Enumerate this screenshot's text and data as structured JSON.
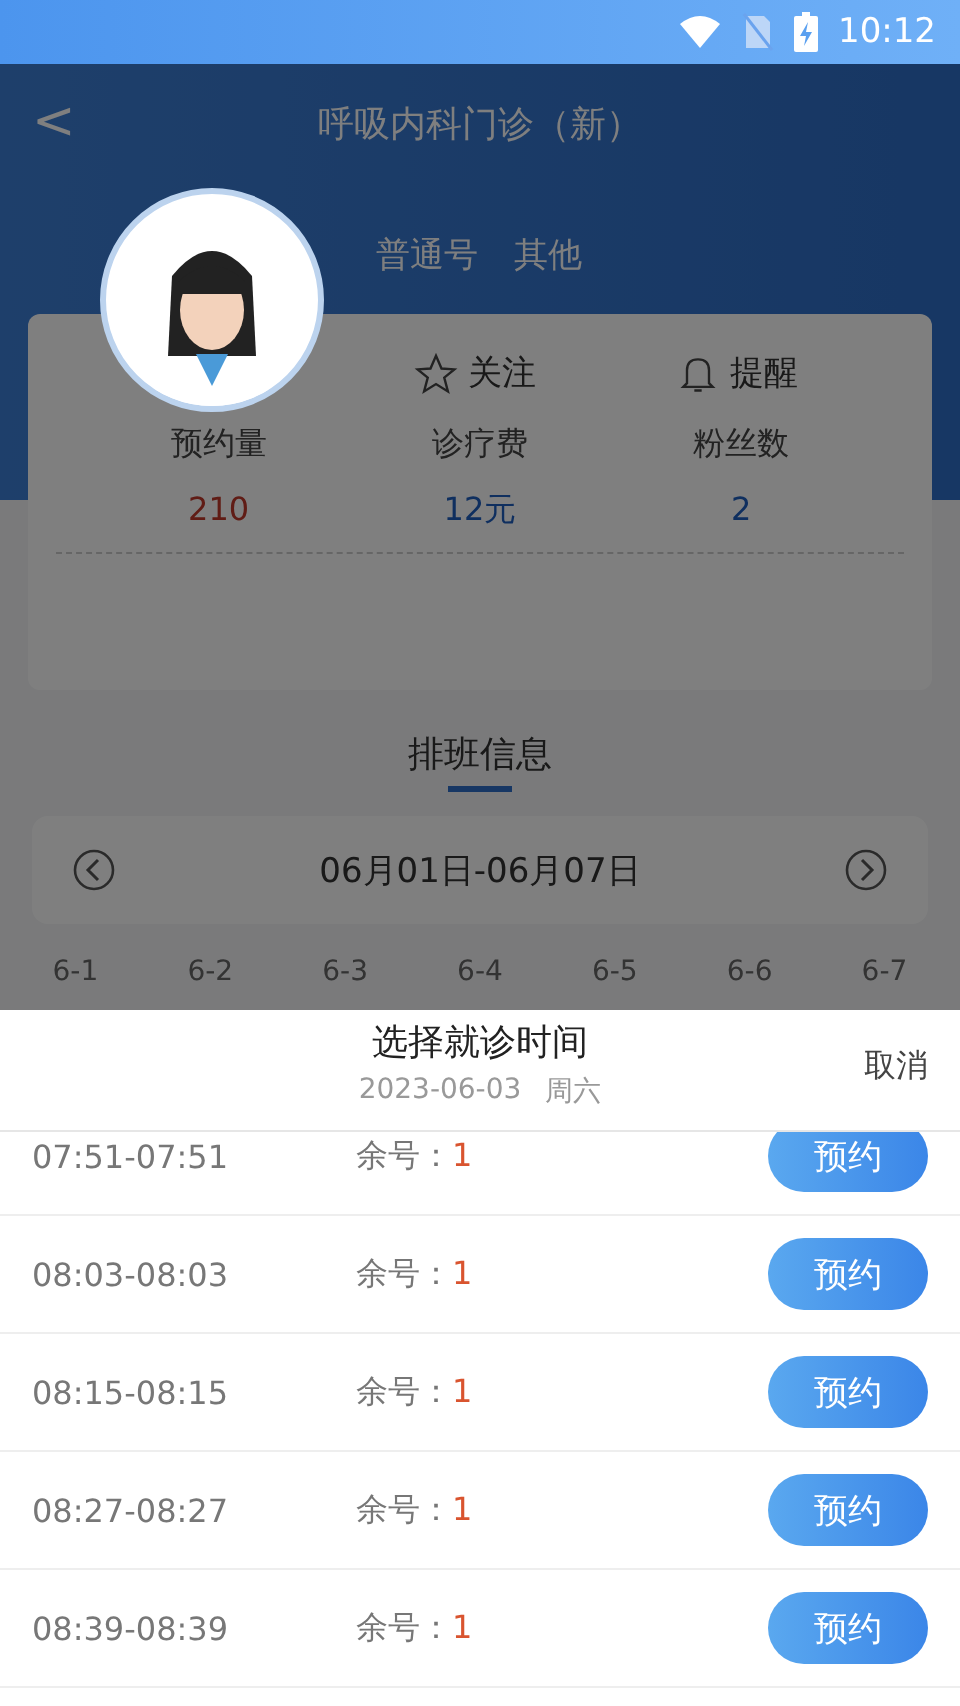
{
  "status_bar": {
    "time": "10:12"
  },
  "header": {
    "back": "<",
    "title": "呼吸内科门诊（新）"
  },
  "doctor": {
    "tags": [
      "普通号",
      "其他"
    ],
    "actions": [
      {
        "kind": "follow",
        "label": "关注"
      },
      {
        "kind": "remind",
        "label": "提醒"
      }
    ],
    "stats": [
      {
        "label": "预约量",
        "value": "210"
      },
      {
        "label": "诊疗费",
        "value": "12元"
      },
      {
        "label": "粉丝数",
        "value": "2"
      }
    ]
  },
  "schedule": {
    "title": "排班信息",
    "range": "06月01日-06月07日",
    "days": [
      "6-1",
      "6-2",
      "6-3",
      "6-4",
      "6-5",
      "6-6",
      "6-7"
    ]
  },
  "sheet": {
    "title": "选择就诊时间",
    "date": "2023-06-03",
    "weekday": "周六",
    "cancel": "取消",
    "slots": [
      {
        "time": "07:51-07:51",
        "remain_label": "余号：",
        "remain": "1",
        "button": "预约"
      },
      {
        "time": "08:03-08:03",
        "remain_label": "余号：",
        "remain": "1",
        "button": "预约"
      },
      {
        "time": "08:15-08:15",
        "remain_label": "余号：",
        "remain": "1",
        "button": "预约"
      },
      {
        "time": "08:27-08:27",
        "remain_label": "余号：",
        "remain": "1",
        "button": "预约"
      },
      {
        "time": "08:39-08:39",
        "remain_label": "余号：",
        "remain": "1",
        "button": "预约"
      }
    ]
  }
}
